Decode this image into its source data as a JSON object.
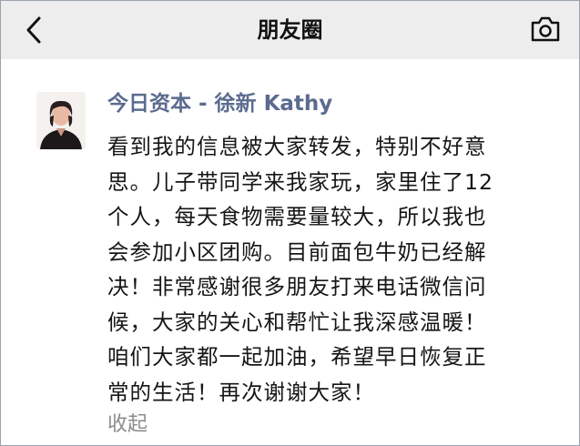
{
  "nav": {
    "title": "朋友圈",
    "back_icon": "chevron-left-icon",
    "camera_icon": "camera-icon"
  },
  "post": {
    "author": "今日资本 - 徐新 Kathy",
    "lines": [
      "看到我的信息被大家转发，特别不好意",
      "思。儿子带同学来我家玩，家里住了12",
      "个人，每天食物需要量较大，所以我也",
      "会参加小区团购。目前面包牛奶已经解",
      "决！非常感谢很多朋友打来电话微信问",
      "候，大家的关心和帮忙让我深感温暖！",
      "咱们大家都一起加油，希望早日恢复正",
      "常的生活！再次谢谢大家！"
    ],
    "collapse_label": "收起"
  },
  "colors": {
    "nav_bg": "#ededed",
    "author_name": "#5b6b8f",
    "body_text": "#161616",
    "muted_text": "#8c8c8c"
  }
}
